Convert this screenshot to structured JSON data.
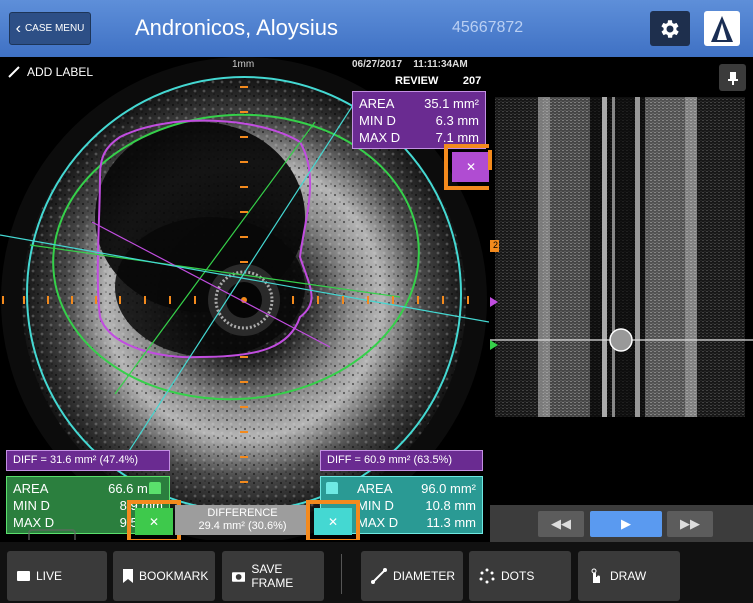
{
  "header": {
    "case_menu": "CASE MENU",
    "patient_name": "Andronicos, Aloysius",
    "patient_id": "45667872"
  },
  "ivus": {
    "add_label": "ADD LABEL",
    "scale": "1mm",
    "date": "06/27/2017",
    "time": "11:11:34AM",
    "mode": "REVIEW",
    "frame": "207"
  },
  "measure_purple": {
    "area_label": "AREA",
    "area": "35.1 mm²",
    "min_label": "MIN D",
    "min": "6.3 mm",
    "max_label": "MAX D",
    "max": "7.1 mm"
  },
  "measure_green": {
    "diff": "DIFF = 31.6 mm² (47.4%)",
    "area_label": "AREA",
    "area": "66.6 mm²",
    "min_label": "MIN D",
    "min": "8.9 mm",
    "max_label": "MAX D",
    "max": "9.5 mm"
  },
  "measure_cyan": {
    "diff": "DIFF = 60.9 mm² (63.5%)",
    "area_label": "AREA",
    "area": "96.0 mm²",
    "min_label": "MIN D",
    "min": "10.8 mm",
    "max_label": "MAX D",
    "max": "11.3 mm"
  },
  "difference": {
    "label": "DIFFERENCE",
    "value": "29.4 mm² (30.6%)"
  },
  "longview": {
    "marker_label": "2",
    "playhead_fraction": 0.53
  },
  "toolbar": {
    "live": "LIVE",
    "bookmark": "BOOKMARK",
    "save_frame": "SAVE FRAME",
    "diameter": "DIAMETER",
    "dots": "DOTS",
    "draw": "DRAW"
  },
  "colors": {
    "purple": "#c14de0",
    "green": "#35d04a",
    "cyan": "#44d8d2",
    "orange": "#f38a1d",
    "header_blue": "#4f80cf"
  }
}
